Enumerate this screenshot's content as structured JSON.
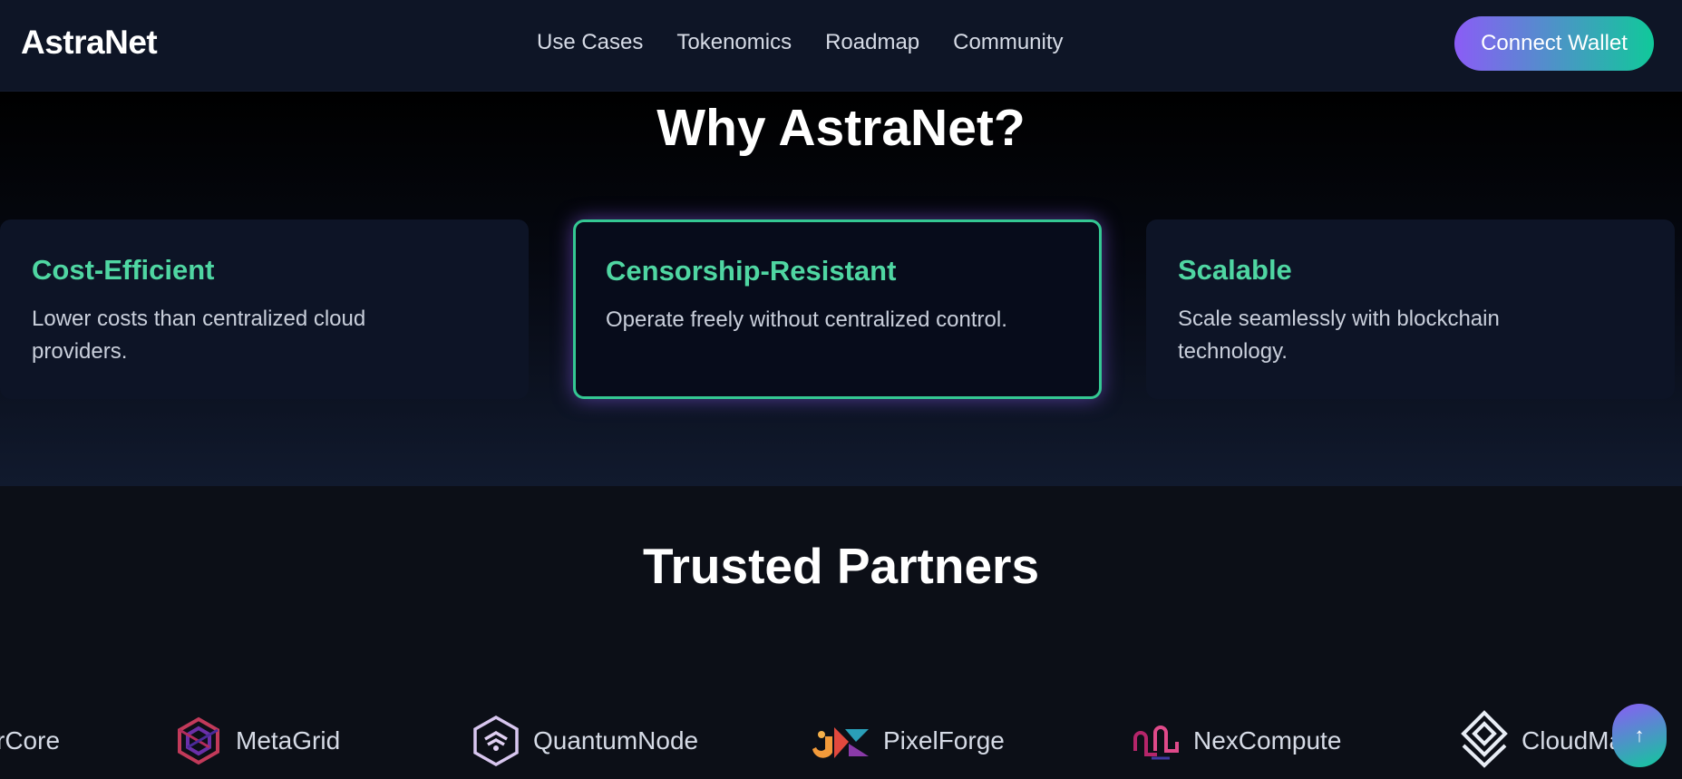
{
  "navbar": {
    "brand": "AstraNet",
    "links": [
      "Use Cases",
      "Tokenomics",
      "Roadmap",
      "Community"
    ],
    "connect_label": "Connect Wallet"
  },
  "why": {
    "title": "Why AstraNet?",
    "cards": [
      {
        "title": "Cost-Efficient",
        "desc": "Lower costs than centralized cloud providers."
      },
      {
        "title": "Censorship-Resistant",
        "desc": "Operate freely without centralized control."
      },
      {
        "title": "Scalable",
        "desc": "Scale seamlessly with blockchain technology."
      }
    ]
  },
  "partners": {
    "title": "Trusted Partners",
    "items": [
      {
        "name": "rCore",
        "icon": "rcore-logo-icon"
      },
      {
        "name": "MetaGrid",
        "icon": "metagrid-logo-icon"
      },
      {
        "name": "QuantumNode",
        "icon": "quantumnode-logo-icon"
      },
      {
        "name": "PixelForge",
        "icon": "pixelforge-logo-icon"
      },
      {
        "name": "NexCompute",
        "icon": "nexcompute-logo-icon"
      },
      {
        "name": "CloudMatrix",
        "icon": "cloudmatrix-logo-icon"
      }
    ]
  },
  "scroll_top": {
    "icon": "arrow-up-icon",
    "glyph": "↑"
  },
  "colors": {
    "accent_green": "#4fd6a2",
    "accent_purple": "#8b5cf6",
    "active_border": "#34c893"
  }
}
